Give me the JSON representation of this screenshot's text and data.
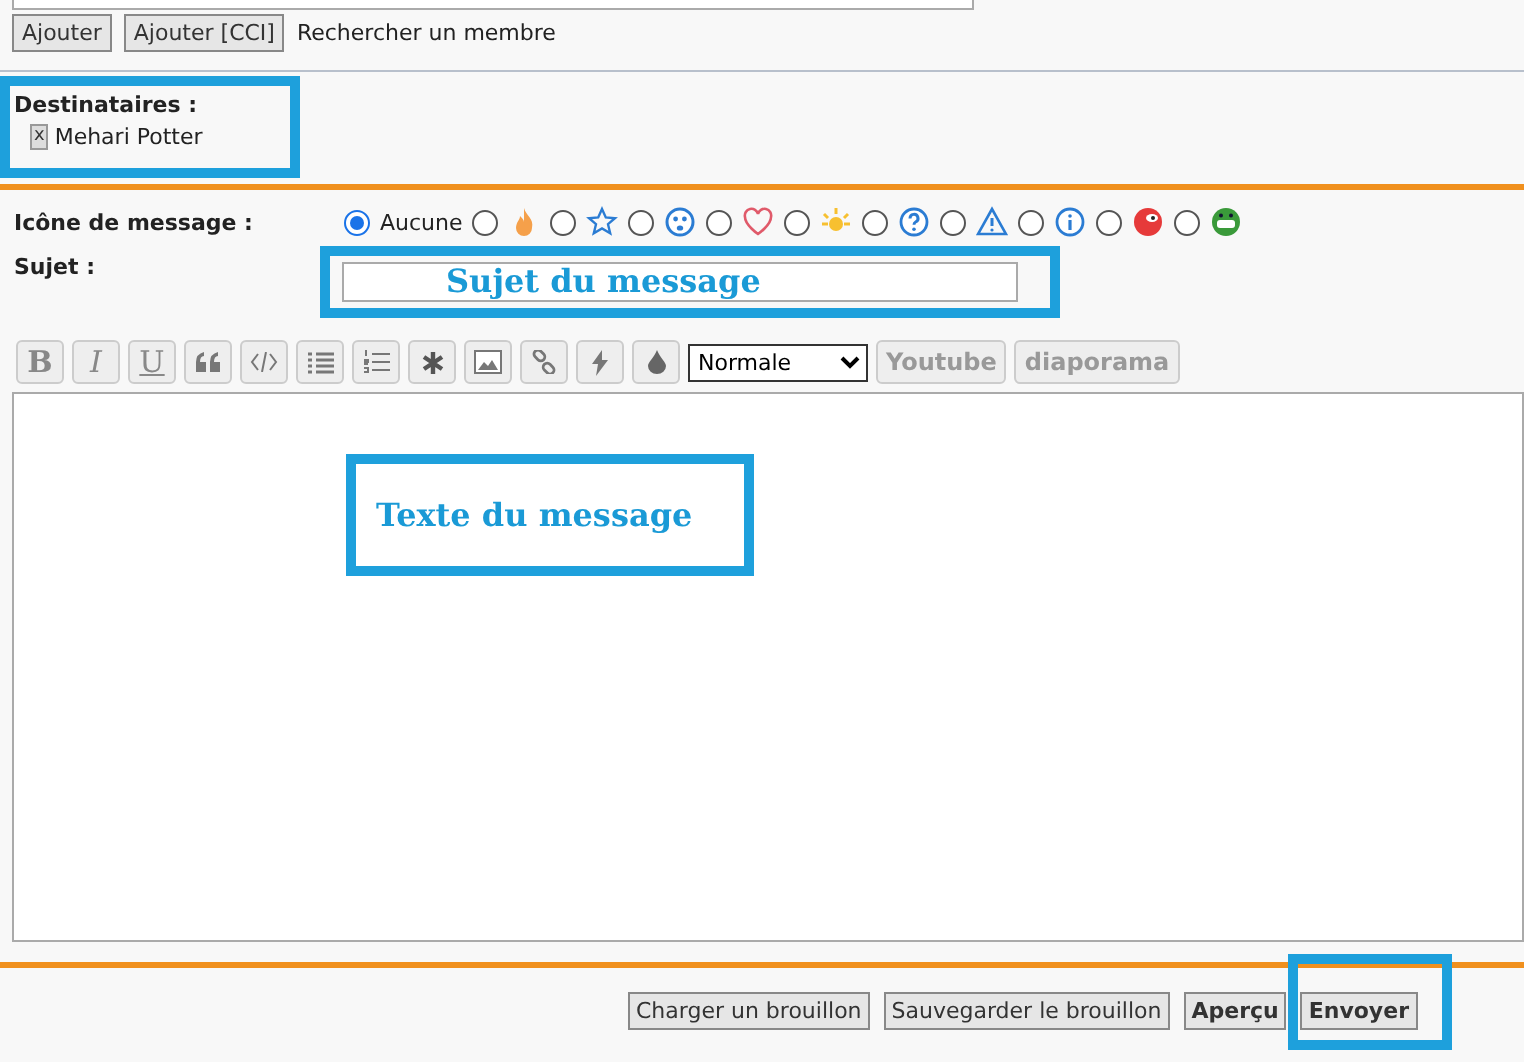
{
  "recipient_bar": {
    "buttons": [
      "Ajouter",
      "Ajouter [CCI]"
    ],
    "search_link": "Rechercher un membre"
  },
  "recipients": {
    "label": "Destinataires :",
    "items": [
      {
        "remove": "x",
        "name": "Mehari Potter"
      }
    ]
  },
  "message_icon": {
    "label": "Icône de message :",
    "options": [
      {
        "kind": "none",
        "text": "Aucune",
        "selected": true
      },
      {
        "kind": "flame",
        "selected": false
      },
      {
        "kind": "star",
        "selected": false
      },
      {
        "kind": "sad",
        "selected": false
      },
      {
        "kind": "heart",
        "selected": false
      },
      {
        "kind": "sun",
        "selected": false
      },
      {
        "kind": "question",
        "selected": false
      },
      {
        "kind": "warning",
        "selected": false
      },
      {
        "kind": "info",
        "selected": false
      },
      {
        "kind": "redface",
        "selected": false
      },
      {
        "kind": "grin",
        "selected": false
      }
    ]
  },
  "subject": {
    "label": "Sujet :",
    "annotation": "Sujet du message"
  },
  "toolbar": {
    "buttons": [
      {
        "kind": "bold",
        "text": "B"
      },
      {
        "kind": "italic",
        "text": "I"
      },
      {
        "kind": "underline",
        "text": "U"
      },
      {
        "kind": "quote"
      },
      {
        "kind": "code"
      },
      {
        "kind": "list"
      },
      {
        "kind": "numbered"
      },
      {
        "kind": "asterisk"
      },
      {
        "kind": "image"
      },
      {
        "kind": "link"
      },
      {
        "kind": "flash"
      },
      {
        "kind": "drop"
      }
    ],
    "size_select": "Normale",
    "extra_buttons": [
      "Youtube",
      "diaporama"
    ]
  },
  "message": {
    "annotation": "Texte du message"
  },
  "actions": [
    {
      "text": "Charger un brouillon",
      "primary": false,
      "highlighted": false
    },
    {
      "text": "Sauvegarder le brouillon",
      "primary": false,
      "highlighted": false
    },
    {
      "text": "Aperçu",
      "primary": true,
      "highlighted": false
    },
    {
      "text": "Envoyer",
      "primary": true,
      "highlighted": true
    }
  ]
}
